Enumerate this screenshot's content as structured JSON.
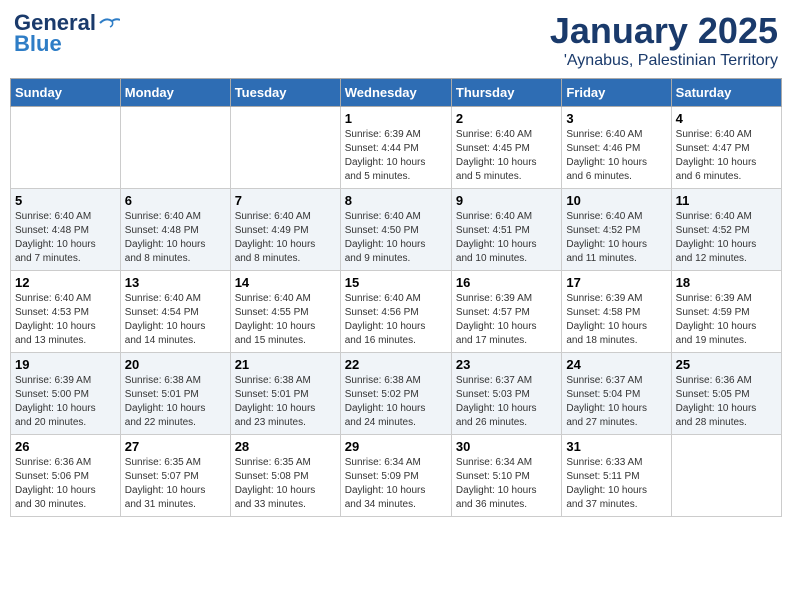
{
  "logo": {
    "line1": "General",
    "line2": "Blue"
  },
  "title": "January 2025",
  "location": "'Aynabus, Palestinian Territory",
  "days_of_week": [
    "Sunday",
    "Monday",
    "Tuesday",
    "Wednesday",
    "Thursday",
    "Friday",
    "Saturday"
  ],
  "weeks": [
    [
      {
        "day": "",
        "info": ""
      },
      {
        "day": "",
        "info": ""
      },
      {
        "day": "",
        "info": ""
      },
      {
        "day": "1",
        "info": "Sunrise: 6:39 AM\nSunset: 4:44 PM\nDaylight: 10 hours\nand 5 minutes."
      },
      {
        "day": "2",
        "info": "Sunrise: 6:40 AM\nSunset: 4:45 PM\nDaylight: 10 hours\nand 5 minutes."
      },
      {
        "day": "3",
        "info": "Sunrise: 6:40 AM\nSunset: 4:46 PM\nDaylight: 10 hours\nand 6 minutes."
      },
      {
        "day": "4",
        "info": "Sunrise: 6:40 AM\nSunset: 4:47 PM\nDaylight: 10 hours\nand 6 minutes."
      }
    ],
    [
      {
        "day": "5",
        "info": "Sunrise: 6:40 AM\nSunset: 4:48 PM\nDaylight: 10 hours\nand 7 minutes."
      },
      {
        "day": "6",
        "info": "Sunrise: 6:40 AM\nSunset: 4:48 PM\nDaylight: 10 hours\nand 8 minutes."
      },
      {
        "day": "7",
        "info": "Sunrise: 6:40 AM\nSunset: 4:49 PM\nDaylight: 10 hours\nand 8 minutes."
      },
      {
        "day": "8",
        "info": "Sunrise: 6:40 AM\nSunset: 4:50 PM\nDaylight: 10 hours\nand 9 minutes."
      },
      {
        "day": "9",
        "info": "Sunrise: 6:40 AM\nSunset: 4:51 PM\nDaylight: 10 hours\nand 10 minutes."
      },
      {
        "day": "10",
        "info": "Sunrise: 6:40 AM\nSunset: 4:52 PM\nDaylight: 10 hours\nand 11 minutes."
      },
      {
        "day": "11",
        "info": "Sunrise: 6:40 AM\nSunset: 4:52 PM\nDaylight: 10 hours\nand 12 minutes."
      }
    ],
    [
      {
        "day": "12",
        "info": "Sunrise: 6:40 AM\nSunset: 4:53 PM\nDaylight: 10 hours\nand 13 minutes."
      },
      {
        "day": "13",
        "info": "Sunrise: 6:40 AM\nSunset: 4:54 PM\nDaylight: 10 hours\nand 14 minutes."
      },
      {
        "day": "14",
        "info": "Sunrise: 6:40 AM\nSunset: 4:55 PM\nDaylight: 10 hours\nand 15 minutes."
      },
      {
        "day": "15",
        "info": "Sunrise: 6:40 AM\nSunset: 4:56 PM\nDaylight: 10 hours\nand 16 minutes."
      },
      {
        "day": "16",
        "info": "Sunrise: 6:39 AM\nSunset: 4:57 PM\nDaylight: 10 hours\nand 17 minutes."
      },
      {
        "day": "17",
        "info": "Sunrise: 6:39 AM\nSunset: 4:58 PM\nDaylight: 10 hours\nand 18 minutes."
      },
      {
        "day": "18",
        "info": "Sunrise: 6:39 AM\nSunset: 4:59 PM\nDaylight: 10 hours\nand 19 minutes."
      }
    ],
    [
      {
        "day": "19",
        "info": "Sunrise: 6:39 AM\nSunset: 5:00 PM\nDaylight: 10 hours\nand 20 minutes."
      },
      {
        "day": "20",
        "info": "Sunrise: 6:38 AM\nSunset: 5:01 PM\nDaylight: 10 hours\nand 22 minutes."
      },
      {
        "day": "21",
        "info": "Sunrise: 6:38 AM\nSunset: 5:01 PM\nDaylight: 10 hours\nand 23 minutes."
      },
      {
        "day": "22",
        "info": "Sunrise: 6:38 AM\nSunset: 5:02 PM\nDaylight: 10 hours\nand 24 minutes."
      },
      {
        "day": "23",
        "info": "Sunrise: 6:37 AM\nSunset: 5:03 PM\nDaylight: 10 hours\nand 26 minutes."
      },
      {
        "day": "24",
        "info": "Sunrise: 6:37 AM\nSunset: 5:04 PM\nDaylight: 10 hours\nand 27 minutes."
      },
      {
        "day": "25",
        "info": "Sunrise: 6:36 AM\nSunset: 5:05 PM\nDaylight: 10 hours\nand 28 minutes."
      }
    ],
    [
      {
        "day": "26",
        "info": "Sunrise: 6:36 AM\nSunset: 5:06 PM\nDaylight: 10 hours\nand 30 minutes."
      },
      {
        "day": "27",
        "info": "Sunrise: 6:35 AM\nSunset: 5:07 PM\nDaylight: 10 hours\nand 31 minutes."
      },
      {
        "day": "28",
        "info": "Sunrise: 6:35 AM\nSunset: 5:08 PM\nDaylight: 10 hours\nand 33 minutes."
      },
      {
        "day": "29",
        "info": "Sunrise: 6:34 AM\nSunset: 5:09 PM\nDaylight: 10 hours\nand 34 minutes."
      },
      {
        "day": "30",
        "info": "Sunrise: 6:34 AM\nSunset: 5:10 PM\nDaylight: 10 hours\nand 36 minutes."
      },
      {
        "day": "31",
        "info": "Sunrise: 6:33 AM\nSunset: 5:11 PM\nDaylight: 10 hours\nand 37 minutes."
      },
      {
        "day": "",
        "info": ""
      }
    ]
  ]
}
